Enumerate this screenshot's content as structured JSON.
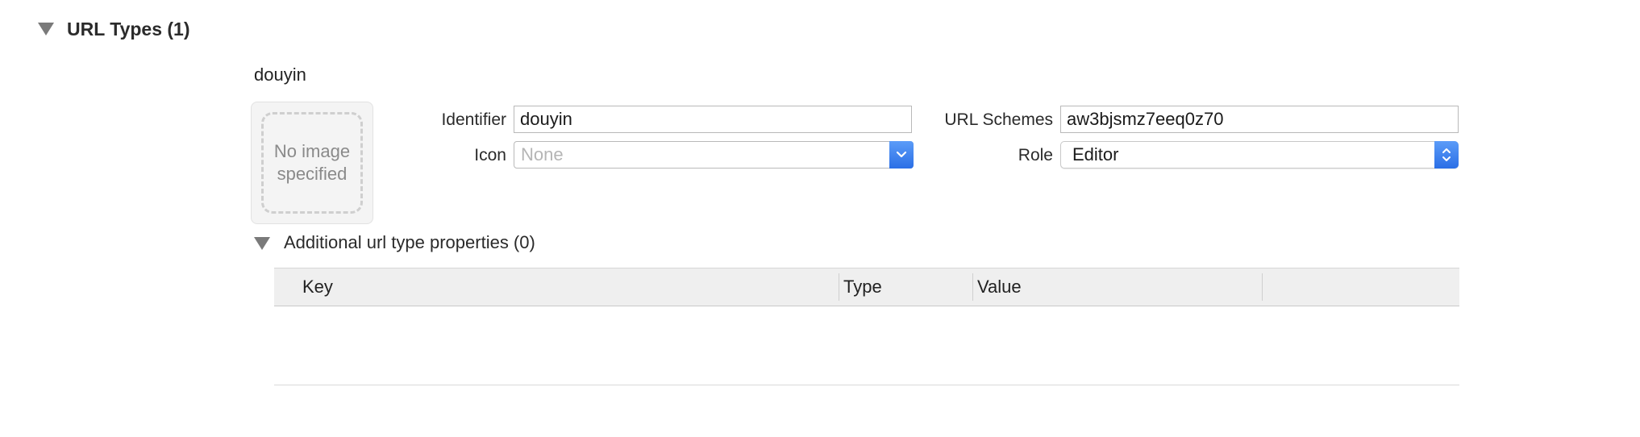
{
  "section": {
    "title": "URL Types (1)"
  },
  "entry": {
    "name": "douyin",
    "image_well": {
      "text": "No image specified"
    },
    "identifier": {
      "label": "Identifier",
      "value": "douyin"
    },
    "icon": {
      "label": "Icon",
      "placeholder": "None"
    },
    "url_schemes": {
      "label": "URL Schemes",
      "value": "aw3bjsmz7eeq0z70"
    },
    "role": {
      "label": "Role",
      "value": "Editor"
    }
  },
  "additional": {
    "title": "Additional url type properties (0)",
    "columns": [
      "Key",
      "Type",
      "Value"
    ],
    "rows": []
  },
  "colors": {
    "accent": "#2b6fe6",
    "header_bg": "#efefef",
    "disclosure": "#7a7a7a"
  },
  "icons": {
    "section_disclosure": "disclosure-triangle-down-icon",
    "combo_arrow": "chevron-down-icon",
    "popup_arrows": "up-down-chevron-icon"
  }
}
